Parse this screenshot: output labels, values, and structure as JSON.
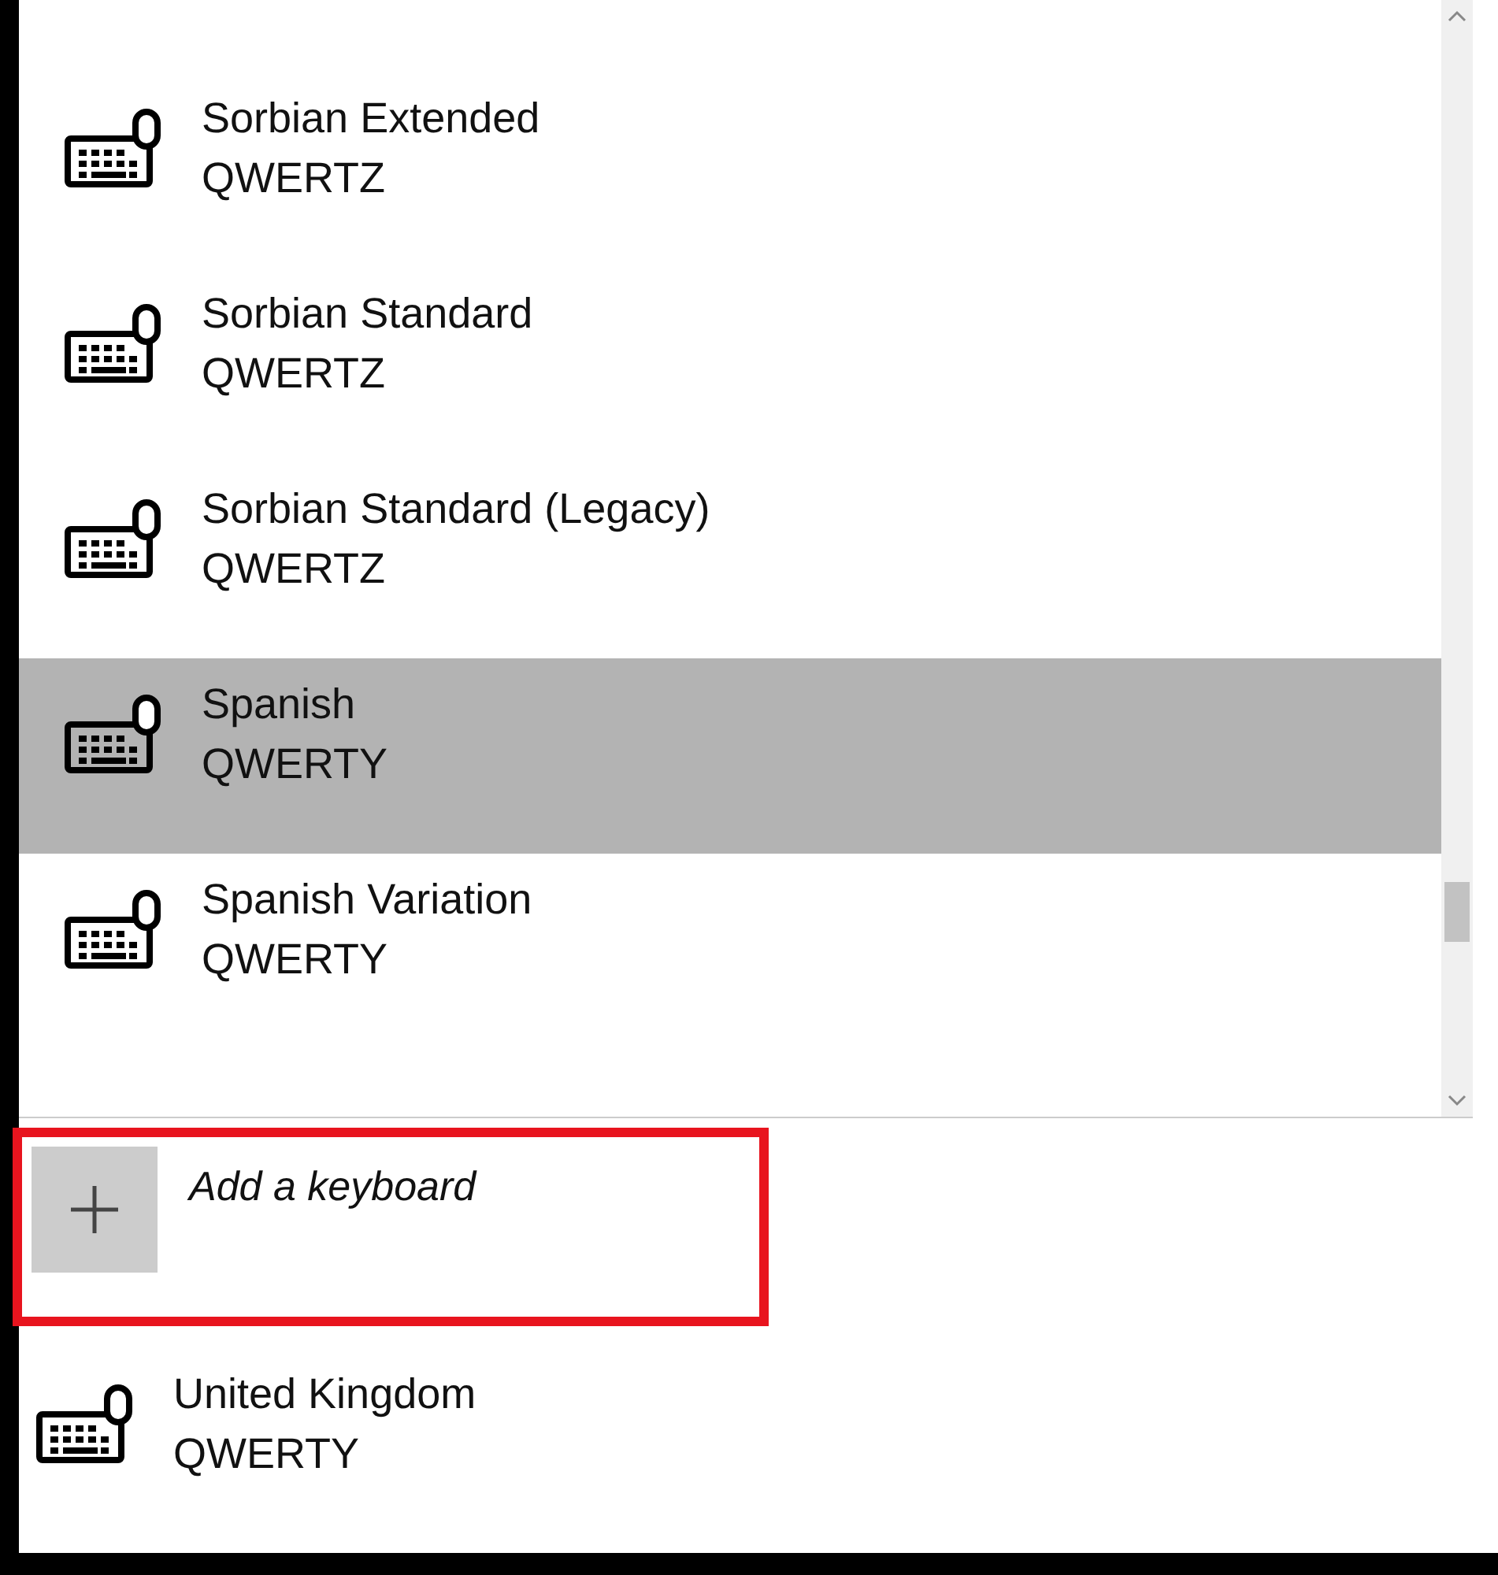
{
  "layout_list": {
    "items": [
      {
        "name": "Sorbian Extended",
        "layout": "QWERTZ",
        "selected": false
      },
      {
        "name": "Sorbian Standard",
        "layout": "QWERTZ",
        "selected": false
      },
      {
        "name": "Sorbian Standard (Legacy)",
        "layout": "QWERTZ",
        "selected": false
      },
      {
        "name": "Spanish",
        "layout": "QWERTY",
        "selected": true
      },
      {
        "name": "Spanish Variation",
        "layout": "QWERTY",
        "selected": false
      }
    ]
  },
  "add_keyboard": {
    "label": "Add a keyboard"
  },
  "installed_keyboards": [
    {
      "name": "United Kingdom",
      "layout": "QWERTY"
    }
  ]
}
